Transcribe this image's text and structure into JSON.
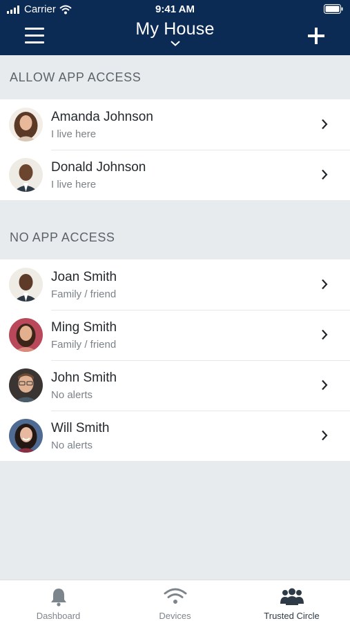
{
  "status_bar": {
    "carrier": "Carrier",
    "time": "9:41 AM"
  },
  "header": {
    "title": "My House"
  },
  "sections": [
    {
      "title": "ALLOW APP ACCESS",
      "people": [
        {
          "name": "Amanda Johnson",
          "subtitle": "I live here"
        },
        {
          "name": "Donald Johnson",
          "subtitle": "I live here"
        }
      ]
    },
    {
      "title": "NO APP ACCESS",
      "people": [
        {
          "name": "Joan Smith",
          "subtitle": "Family / friend"
        },
        {
          "name": "Ming Smith",
          "subtitle": "Family / friend"
        },
        {
          "name": "John Smith",
          "subtitle": "No alerts"
        },
        {
          "name": "Will Smith",
          "subtitle": "No alerts"
        }
      ]
    }
  ],
  "tabbar": {
    "tabs": [
      {
        "label": "Dashboard",
        "icon": "bell-icon",
        "active": false
      },
      {
        "label": "Devices",
        "icon": "wifi-icon",
        "active": false
      },
      {
        "label": "Trusted Circle",
        "icon": "group-icon",
        "active": true
      }
    ]
  },
  "colors": {
    "header_bg": "#0b2b55",
    "page_bg": "#e7ebee",
    "active_tab": "#2e3a45"
  },
  "icons": [
    "signal-icon",
    "wifi-icon",
    "battery-icon",
    "menu-icon",
    "chevron-down-icon",
    "plus-icon",
    "chevron-right-icon",
    "avatar",
    "bell-icon",
    "group-icon"
  ]
}
